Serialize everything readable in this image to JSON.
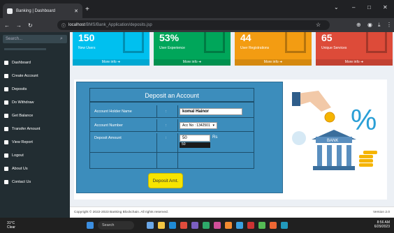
{
  "browser": {
    "tab_title": "Banking | Dashboard",
    "url_host": "localhost",
    "url_path": "/BMS/Bank_Application/deposits.jsp",
    "window_min": "–",
    "window_max": "□",
    "window_close": "✕"
  },
  "sidebar": {
    "search_placeholder": "Search...",
    "items": [
      {
        "label": "Dashboard"
      },
      {
        "label": "Create Account"
      },
      {
        "label": "Deposits"
      },
      {
        "label": "Do Withdraw"
      },
      {
        "label": "Get Balance"
      },
      {
        "label": "Transfer Amount"
      },
      {
        "label": "View Report"
      },
      {
        "label": "Logout"
      },
      {
        "label": "About Us"
      },
      {
        "label": "Contact Us"
      }
    ]
  },
  "stats": [
    {
      "value": "150",
      "label": "New Users",
      "more": "More info",
      "color": "#00c0ef"
    },
    {
      "value": "53%",
      "label": "User Experience",
      "more": "More info",
      "color": "#00a65a"
    },
    {
      "value": "44",
      "label": "User Registrations",
      "more": "More info",
      "color": "#f39c12"
    },
    {
      "value": "65",
      "label": "Unique Services",
      "more": "More info",
      "color": "#dd4b39"
    }
  ],
  "form": {
    "title": "Deposit an Account",
    "holder_label": "Account Holder Name",
    "holder_sep": ":",
    "holder_value": "komal Hainor",
    "number_label": "Account Number",
    "number_sep": ":",
    "number_value": "Acc No : 1342501",
    "amount_label": "Deposit Amount",
    "amount_sep": ":",
    "amount_value": "50",
    "amount_unit": "Rs",
    "amount_suggest": "50",
    "button": "Deposit Amt."
  },
  "art": {
    "percent": "%",
    "bank": "BANK"
  },
  "footer": {
    "copyright": "Copyright © 2022-2023 Banking Blockchain. All rights reserved.",
    "version": "Version 2.0"
  },
  "taskbar": {
    "temp": "31°C",
    "weather": "Clear",
    "search": "Search",
    "time": "8:56 AM",
    "date": "6/29/2023"
  }
}
